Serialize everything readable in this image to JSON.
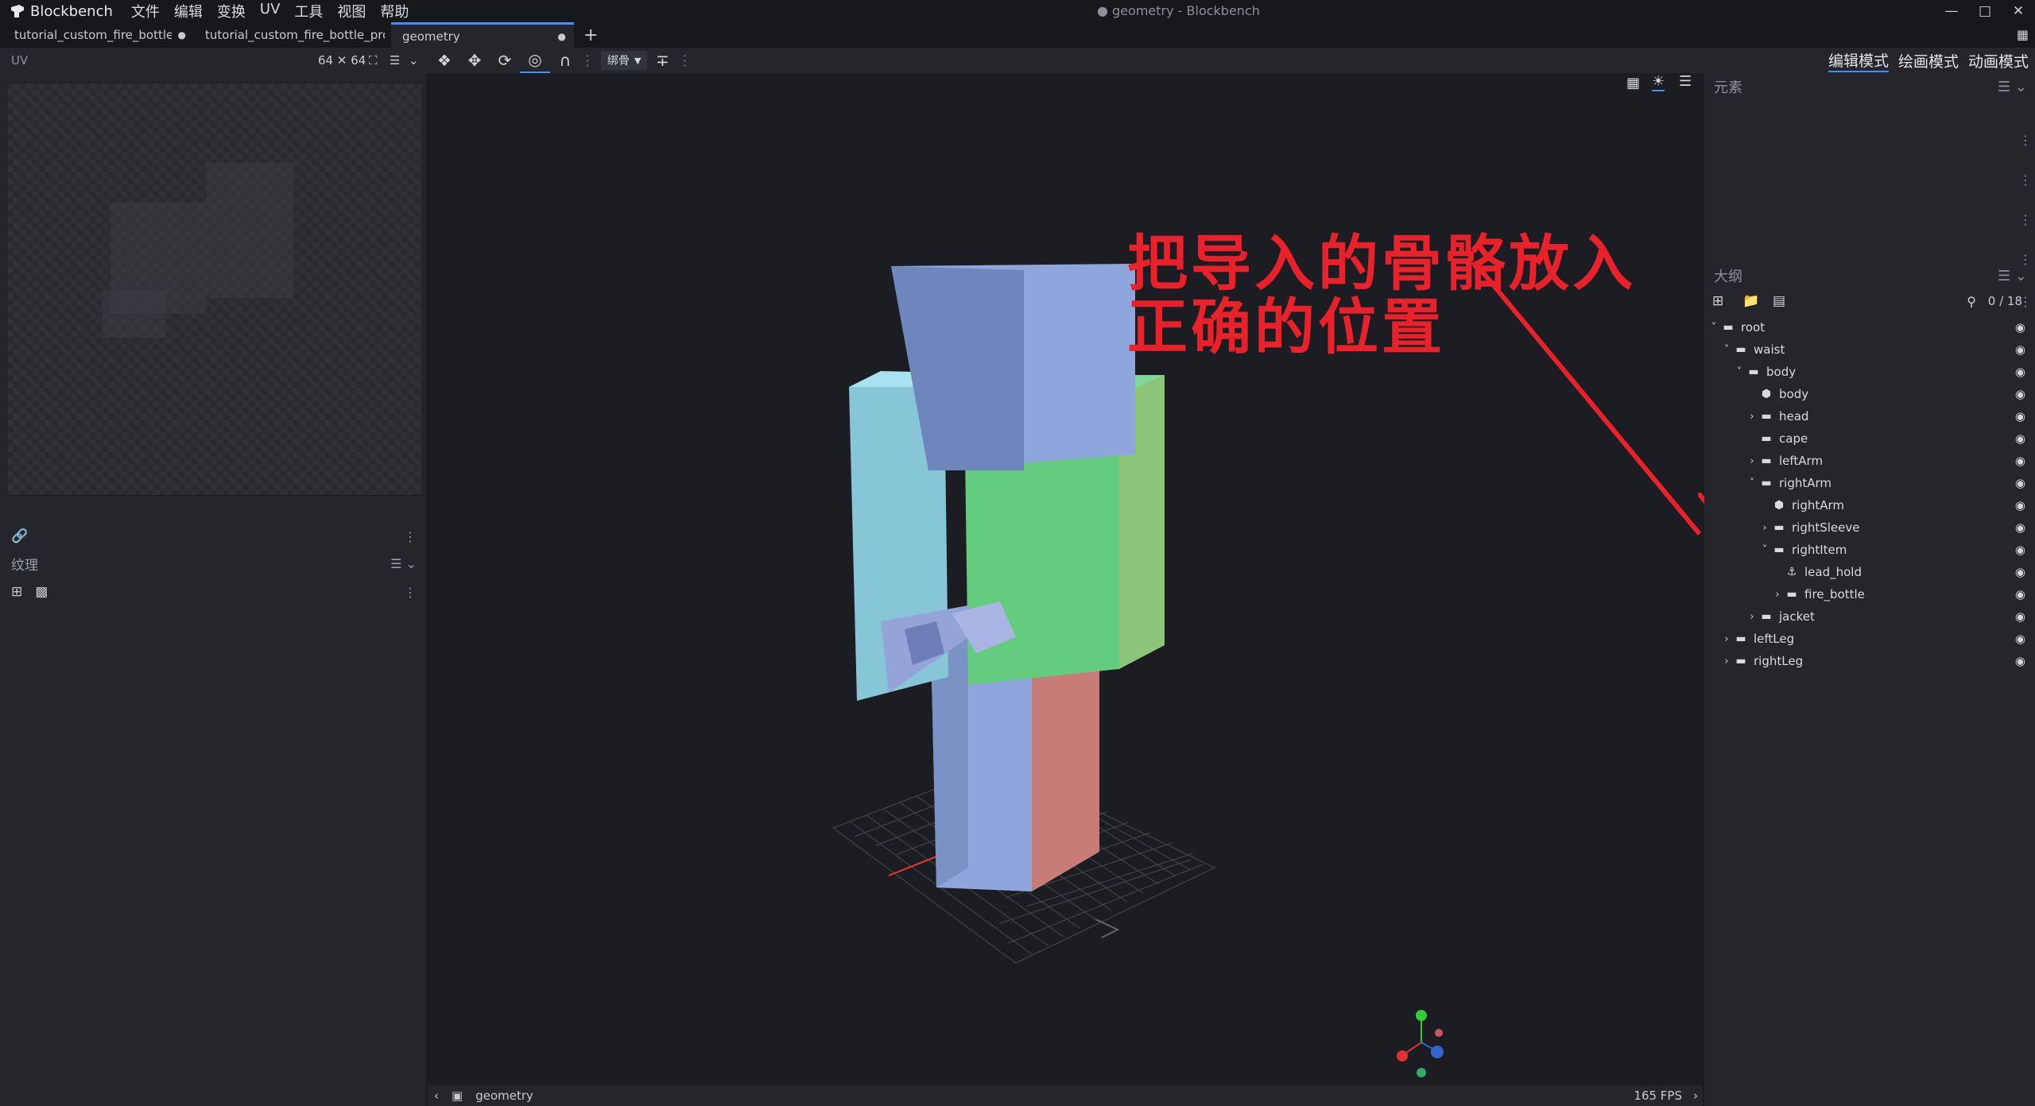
{
  "app": {
    "name": "Blockbench",
    "window_title": "● geometry - Blockbench",
    "menu": [
      "文件",
      "编辑",
      "变换",
      "UV",
      "工具",
      "视图",
      "帮助"
    ]
  },
  "tabs": [
    {
      "label": "tutorial_custom_fire_bottle.ge",
      "modified": "●"
    },
    {
      "label": "tutorial_custom_fire_bottle_proje",
      "modified": ""
    },
    {
      "label": "geometry",
      "modified": "●"
    }
  ],
  "uv_panel": {
    "title": "UV",
    "resolution": "64 ✕ 64"
  },
  "toolbar": {
    "bone_select": "绑骨"
  },
  "modes": [
    "编辑模式",
    "绘画模式",
    "动画模式"
  ],
  "textures_panel": {
    "title": "纹理"
  },
  "elements_panel": {
    "title": "元素"
  },
  "outliner": {
    "title": "大纲",
    "count": "0 / 18",
    "nodes": [
      {
        "label": "root",
        "type": "folder",
        "depth": 0,
        "expand": "open"
      },
      {
        "label": "waist",
        "type": "folder",
        "depth": 1,
        "expand": "open"
      },
      {
        "label": "body",
        "type": "folder",
        "depth": 2,
        "expand": "open"
      },
      {
        "label": "body",
        "type": "cube",
        "depth": 3,
        "expand": "none"
      },
      {
        "label": "head",
        "type": "folder",
        "depth": 3,
        "expand": "closed"
      },
      {
        "label": "cape",
        "type": "folder",
        "depth": 3,
        "expand": "none"
      },
      {
        "label": "leftArm",
        "type": "folder",
        "depth": 3,
        "expand": "closed"
      },
      {
        "label": "rightArm",
        "type": "folder",
        "depth": 3,
        "expand": "open"
      },
      {
        "label": "rightArm",
        "type": "cube",
        "depth": 4,
        "expand": "none"
      },
      {
        "label": "rightSleeve",
        "type": "folder",
        "depth": 4,
        "expand": "closed"
      },
      {
        "label": "rightItem",
        "type": "folder",
        "depth": 4,
        "expand": "open"
      },
      {
        "label": "lead_hold",
        "type": "locator",
        "depth": 5,
        "expand": "none"
      },
      {
        "label": "fire_bottle",
        "type": "folder",
        "depth": 5,
        "expand": "closed"
      },
      {
        "label": "jacket",
        "type": "folder",
        "depth": 3,
        "expand": "closed"
      },
      {
        "label": "leftLeg",
        "type": "folder",
        "depth": 1,
        "expand": "closed"
      },
      {
        "label": "rightLeg",
        "type": "folder",
        "depth": 1,
        "expand": "closed"
      }
    ]
  },
  "annotation": {
    "line1": "把导入的骨骼放入",
    "line2": "正确的位置",
    "color": "#e8212a"
  },
  "status": {
    "model": "geometry",
    "fps": "165 FPS"
  },
  "colors": {
    "accent": "#3e90ff",
    "head": "#8ea6dc",
    "body": "#63cc7e",
    "arm": "#86c6d6",
    "leg_right": "#c77c78",
    "leg_left": "#8ea6dc"
  }
}
